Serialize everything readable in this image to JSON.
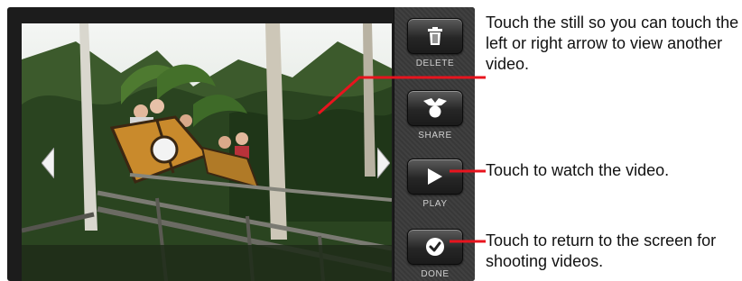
{
  "sidebar": {
    "buttons": [
      {
        "label": "DELETE",
        "icon": "trash-icon"
      },
      {
        "label": "SHARE",
        "icon": "share-icon"
      },
      {
        "label": "PLAY",
        "icon": "play-icon"
      },
      {
        "label": "DONE",
        "icon": "check-icon"
      }
    ]
  },
  "navigation": {
    "left_icon": "arrow-left-icon",
    "right_icon": "arrow-right-icon"
  },
  "callouts": {
    "still": "Touch the still so you can touch the left or right arrow to view another video.",
    "play": "Touch to watch the video.",
    "done": "Touch to return to the screen for shooting videos."
  },
  "colors": {
    "callout_line": "#e8141e",
    "sidebar": "#3a3a3a",
    "label": "#d0d0d0"
  }
}
